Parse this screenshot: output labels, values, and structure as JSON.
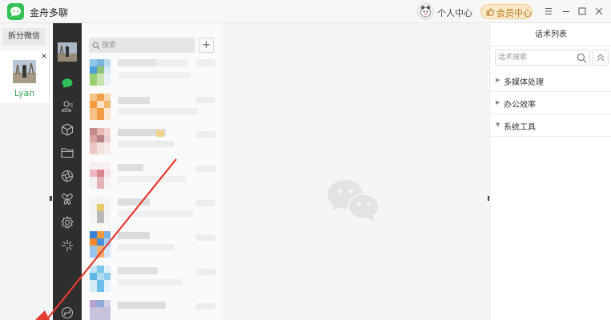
{
  "app": {
    "title": "金舟多聊"
  },
  "header": {
    "personal_center": "个人中心",
    "vip_center": "会员中心"
  },
  "accounts": {
    "split_button": "拆分微信",
    "items": [
      {
        "name": "Lyan",
        "close": "×"
      }
    ]
  },
  "nav": {
    "icons": [
      "chat-icon",
      "contacts-icon",
      "box-icon",
      "folder-icon",
      "aperture-icon",
      "butterfly-icon",
      "settings-icon",
      "sparkle-icon",
      "mini-program-icon"
    ]
  },
  "chat_list": {
    "search_placeholder": "搜索",
    "add_label": "+"
  },
  "right_panel": {
    "title": "话术列表",
    "search_placeholder": "话术搜索",
    "categories": [
      {
        "label": "多媒体处理",
        "expanded": false
      },
      {
        "label": "办公效率",
        "expanded": false
      },
      {
        "label": "系统工具",
        "expanded": true
      }
    ]
  },
  "colors": {
    "brand_green": "#33c254",
    "nav_dark": "#2e2e2e",
    "vip_gold": "#b8741d",
    "arrow_red": "#e53a33"
  }
}
